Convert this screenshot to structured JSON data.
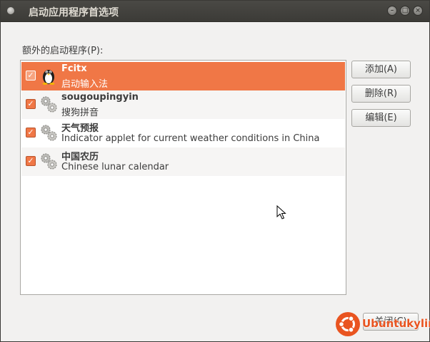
{
  "window": {
    "title": "启动应用程序首选项",
    "controls": [
      "minimize-icon",
      "maximize-icon",
      "close-icon"
    ]
  },
  "section_label": "额外的启动程序(P):",
  "startup_programs": [
    {
      "name": "Fcitx",
      "description": "启动输入法",
      "checked": true,
      "selected": true,
      "icon": "penguin-icon"
    },
    {
      "name": "sougoupingyin",
      "description": "搜狗拼音",
      "checked": true,
      "selected": false,
      "icon": "gears-icon"
    },
    {
      "name": "天气预报",
      "description": "Indicator applet for current weather conditions in China",
      "checked": true,
      "selected": false,
      "icon": "gears-icon"
    },
    {
      "name": "中国农历",
      "description": "Chinese lunar calendar",
      "checked": true,
      "selected": false,
      "icon": "gears-icon"
    }
  ],
  "buttons": {
    "add": "添加(A)",
    "remove": "删除(R)",
    "edit": "编辑(E)",
    "close": "关闭(C)"
  },
  "watermark": {
    "text": "Ubuntukylin"
  },
  "colors": {
    "accent": "#f07746",
    "titlebar": "#3c3b37",
    "brand": "#e95420"
  }
}
